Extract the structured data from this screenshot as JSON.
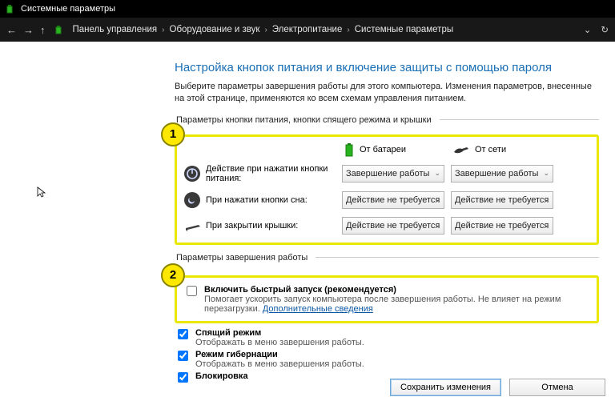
{
  "window": {
    "title": "Системные параметры"
  },
  "breadcrumb": {
    "items": [
      "Панель управления",
      "Оборудование и звук",
      "Электропитание",
      "Системные параметры"
    ]
  },
  "page": {
    "heading": "Настройка кнопок питания и включение защиты с помощью пароля",
    "description": "Выберите параметры завершения работы для этого компьютера. Изменения параметров, внесенные на этой странице, применяются ко всем схемам управления питанием."
  },
  "annotations": {
    "badge1": "1",
    "badge2": "2"
  },
  "section1": {
    "legend": "Параметры кнопки питания, кнопки спящего режима и крышки",
    "col_battery": "От батареи",
    "col_ac": "От сети",
    "rows": [
      {
        "label": "Действие при нажатии кнопки питания:",
        "battery": "Завершение работы",
        "ac": "Завершение работы"
      },
      {
        "label": "При нажатии кнопки сна:",
        "battery": "Действие не требуется",
        "ac": "Действие не требуется"
      },
      {
        "label": "При закрытии крышки:",
        "battery": "Действие не требуется",
        "ac": "Действие не требуется"
      }
    ]
  },
  "section2": {
    "legend": "Параметры завершения работы",
    "items": [
      {
        "title": "Включить быстрый запуск (рекомендуется)",
        "sub": "Помогает ускорить запуск компьютера после завершения работы. Не влияет на режим перезагрузки.",
        "link": "Дополнительные сведения",
        "checked": false
      },
      {
        "title": "Спящий режим",
        "sub": "Отображать в меню завершения работы.",
        "checked": true
      },
      {
        "title": "Режим гибернации",
        "sub": "Отображать в меню завершения работы.",
        "checked": true
      },
      {
        "title": "Блокировка",
        "sub": "",
        "checked": true
      }
    ]
  },
  "footer": {
    "save": "Сохранить изменения",
    "cancel": "Отмена"
  }
}
